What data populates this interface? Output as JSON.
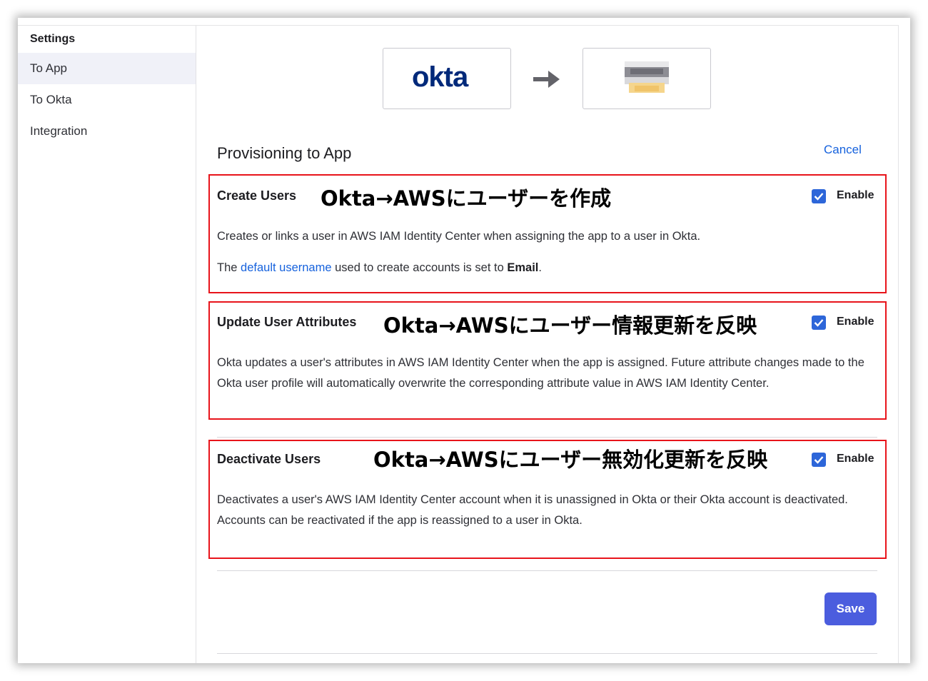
{
  "sidebar": {
    "title": "Settings",
    "items": [
      {
        "label": "To App"
      },
      {
        "label": "To Okta"
      },
      {
        "label": "Integration"
      }
    ]
  },
  "header": {
    "source_logo_text": "okta"
  },
  "page": {
    "title": "Provisioning to App",
    "cancel_label": "Cancel"
  },
  "sections": [
    {
      "title": "Create Users",
      "annotation": "Okta→AWSにユーザーを作成",
      "enable_label": "Enable",
      "checked": true,
      "desc1": "Creates or links a user in AWS IAM Identity Center when assigning the app to a user in Okta.",
      "desc2_prefix": "The ",
      "desc2_link": "default username",
      "desc2_mid": " used to create accounts is set to ",
      "desc2_bold": "Email",
      "desc2_suffix": "."
    },
    {
      "title": "Update User Attributes",
      "annotation": "Okta→AWSにユーザー情報更新を反映",
      "enable_label": "Enable",
      "checked": true,
      "desc1": "Okta updates a user's attributes in AWS IAM Identity Center when the app is assigned. Future attribute changes made to the Okta user profile will automatically overwrite the corresponding attribute value in AWS IAM Identity Center."
    },
    {
      "title": "Deactivate Users",
      "annotation": "Okta→AWSにユーザー無効化更新を反映",
      "enable_label": "Enable",
      "checked": true,
      "desc1": "Deactivates a user's AWS IAM Identity Center account when it is unassigned in Okta or their Okta account is deactivated. Accounts can be reactivated if the app is reassigned to a user in Okta."
    }
  ],
  "footer": {
    "save_label": "Save"
  },
  "colors": {
    "okta_navy": "#00297a",
    "link_blue": "#1662dd",
    "checkbox_blue": "#2d66d9",
    "save_button": "#4b5dde",
    "annotation_red": "#e8141b"
  }
}
